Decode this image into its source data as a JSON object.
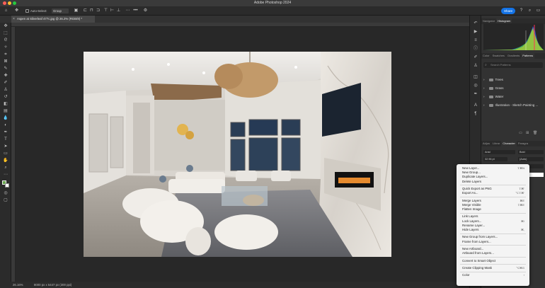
{
  "app": {
    "window_title": "Adobe Photoshop 2024",
    "share_label": "Share"
  },
  "options_bar": {
    "auto_select_label": "Auto-Select:",
    "auto_select_value": "Group"
  },
  "document": {
    "tab_title": "Aspen at Silverleaf 477c.jpg @ 26.2% (RGB/8) *",
    "zoom": "26.16%",
    "doc_info": "8000 px x 5447 px (300 ppi)"
  },
  "right_panel": {
    "top_tabs": [
      "Navigator",
      "Histogram"
    ],
    "mid_tabs": [
      "Color",
      "Swatches",
      "Gradients",
      "Patterns"
    ],
    "pattern_search_placeholder": "Search Patterns",
    "pattern_folders": [
      "Trees",
      "Grass",
      "Water",
      "Illustration - Sketch Painting ..."
    ],
    "lower_tabs": [
      "Adjus",
      "Librar",
      "Character",
      "Paragra"
    ],
    "font_family": "Arial",
    "font_style": "Bold",
    "font_size": "32.96 pt",
    "leading": "(Auto)"
  },
  "context_menu": {
    "groups": [
      [
        {
          "label": "New Layer...",
          "shortcut": "⇧⌘N",
          "enabled": true
        },
        {
          "label": "New Group...",
          "shortcut": "",
          "enabled": true
        },
        {
          "label": "Duplicate Layers...",
          "shortcut": "",
          "enabled": true
        },
        {
          "label": "Delete Layers",
          "shortcut": "",
          "enabled": true
        }
      ],
      [
        {
          "label": "Quick Export as PNG",
          "shortcut": "⇧⌘'",
          "enabled": true
        },
        {
          "label": "Export As...",
          "shortcut": "⌥⇧⌘'",
          "enabled": true
        }
      ],
      [
        {
          "label": "Merge Layers",
          "shortcut": "⌘E",
          "enabled": true
        },
        {
          "label": "Merge Visible",
          "shortcut": "⇧⌘E",
          "enabled": true
        },
        {
          "label": "Flatten Image",
          "shortcut": "",
          "enabled": true
        }
      ],
      [
        {
          "label": "Link Layers",
          "shortcut": "",
          "enabled": true
        },
        {
          "label": "Lock Layers...",
          "shortcut": "⌘/",
          "enabled": true
        },
        {
          "label": "Rename Layer...",
          "shortcut": "",
          "enabled": true
        },
        {
          "label": "Hide Layers",
          "shortcut": "⌘,",
          "enabled": true
        }
      ],
      [
        {
          "label": "New Group from Layers...",
          "shortcut": "",
          "enabled": true
        },
        {
          "label": "Frame from Layers...",
          "shortcut": "",
          "enabled": true
        }
      ],
      [
        {
          "label": "New Artboard...",
          "shortcut": "",
          "enabled": true
        },
        {
          "label": "Artboard from Layers...",
          "shortcut": "",
          "enabled": true
        }
      ],
      [
        {
          "label": "Convert to Smart Object",
          "shortcut": "",
          "enabled": true
        }
      ],
      [
        {
          "label": "Create Clipping Mask",
          "shortcut": "⌥⌘G",
          "enabled": true
        }
      ],
      [
        {
          "label": "Color",
          "shortcut": "›",
          "enabled": true
        }
      ]
    ]
  },
  "colors": {
    "accent": "#1473e6",
    "panel_bg": "#323232",
    "canvas_bg": "#282828",
    "menu_bg": "#f4f4f4"
  },
  "icons": {
    "tools": [
      "move-icon",
      "marquee-icon",
      "lasso-icon",
      "magic-wand-icon",
      "crop-icon",
      "frame-icon",
      "eyedropper-icon",
      "healing-icon",
      "brush-icon",
      "stamp-icon",
      "history-brush-icon",
      "eraser-icon",
      "gradient-icon",
      "blur-icon",
      "dodge-icon",
      "pen-icon",
      "type-icon",
      "path-select-icon",
      "shape-icon",
      "hand-icon",
      "zoom-icon",
      "more-tools-icon"
    ]
  }
}
